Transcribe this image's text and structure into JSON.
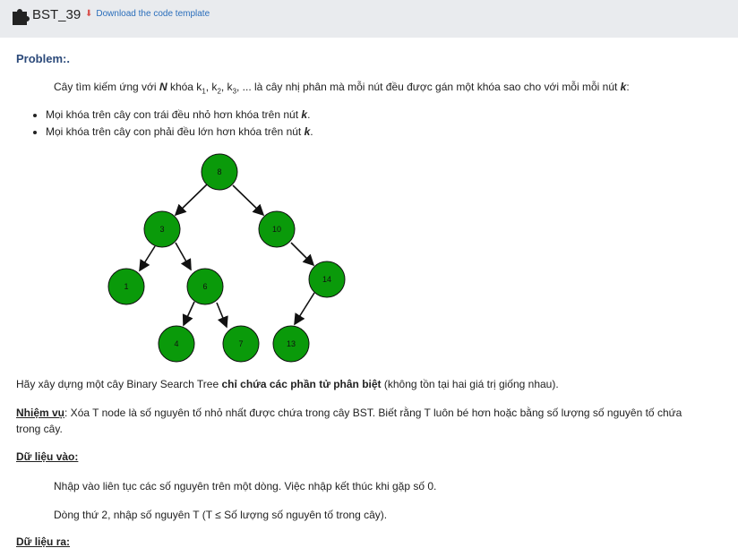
{
  "header": {
    "title": "BST_39",
    "download_label": "Download the code template"
  },
  "problem": {
    "label": "Problem:.",
    "intro_a": "Cây tìm kiếm ứng với ",
    "intro_n": "N",
    "intro_b": " khóa k",
    "k1": "1",
    "sep1": ", k",
    "k2": "2",
    "sep2": ", k",
    "k3": "3",
    "intro_c": ", ... là cây nhị phân mà mỗi nút đều được gán một khóa sao cho với mỗi mỗi nút ",
    "intro_k": "k",
    "intro_end": ":",
    "bullets": [
      {
        "text": "Mọi khóa trên cây con trái đều nhỏ hơn khóa trên nút ",
        "k": "k",
        "end": "."
      },
      {
        "text": "Mọi khóa trên cây con phải đều lớn hơn khóa trên nút ",
        "k": "k",
        "end": "."
      }
    ]
  },
  "tree": {
    "node_color": "#0a9a0a",
    "nodes": [
      "8",
      "3",
      "10",
      "1",
      "6",
      "14",
      "4",
      "7",
      "13"
    ]
  },
  "hay": {
    "a": "Hãy xây dựng một cây Binary Search Tree ",
    "b": "chỉ chứa các phần tử phân biệt",
    "c": " (không tồn tại hai giá trị giống nhau)."
  },
  "task": {
    "label": "Nhiệm vụ",
    "text": ": Xóa T node là số nguyên tố nhỏ nhất được chứa trong cây BST. Biết rằng T luôn bé hơn hoặc bằng số lượng số nguyên tố chứa trong cây."
  },
  "input": {
    "label": "Dữ liệu vào:",
    "line1": "Nhập vào liên tục các số nguyên trên một dòng. Việc nhập kết thúc khi gặp số 0.",
    "line2": "Dòng thứ 2, nhập số nguyên T (T ≤ Số lượng số nguyên tố trong cây)."
  },
  "output": {
    "label": "Dữ liệu ra:"
  }
}
